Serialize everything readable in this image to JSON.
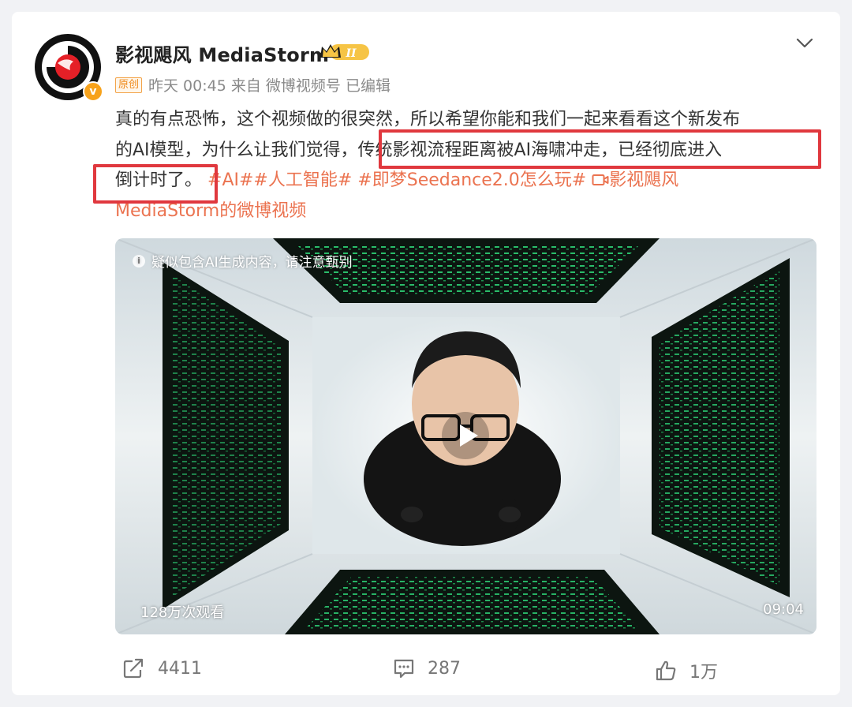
{
  "post": {
    "username": "影视飓风 MediaStorm",
    "crown_badge_label": "II",
    "verified_badge": "v",
    "original_tag": "原创",
    "time": "昨天 00:45",
    "source_prefix": "来自",
    "source": "微博视频号",
    "edited": "已编辑",
    "content": {
      "text_line1": "真的有点恐怖，这个视频做的很突然，所以希望你能和我们一起来看看这个新发布",
      "text_line2a": "的AI模型，为什么让我们觉得，",
      "text_highlight_a": "传统影视流程距离被AI海啸冲走，已经彻底进入",
      "text_highlight_b": "倒计时了。",
      "tags": [
        "#AI#",
        "#人工智能#",
        "#即梦Seedance2.0怎么玩#"
      ],
      "video_link_icon": "video-link-icon",
      "video_link_line1": "影视飓风",
      "video_link_line2": "MediaStorm的微博视频"
    }
  },
  "video": {
    "ai_notice": "疑似包含AI生成内容，请注意甄别",
    "views": "128万次观看",
    "duration": "09:04"
  },
  "actions": {
    "share_count": "4411",
    "comment_count": "287",
    "like_count": "1万"
  },
  "colors": {
    "accent_orange": "#eb7350",
    "highlight_red": "#e0383e",
    "badge_gold": "#f7a21b"
  }
}
